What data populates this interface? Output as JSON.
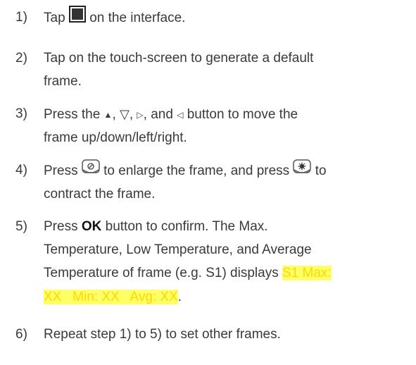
{
  "steps": [
    {
      "number": "1)",
      "before_icon": "Tap",
      "icon": "stop-square-icon",
      "after_icon": "on the interface."
    },
    {
      "number": "2)",
      "line1": "Tap on the touch-screen to generate a default",
      "line2": "frame."
    },
    {
      "number": "3)",
      "press": "Press the",
      "up_glyph": "▲",
      "sep1": ",",
      "down_glyph": "▽",
      "sep2": ",",
      "right_glyph": "▷",
      "sep3": ", and",
      "left_glyph": "◁",
      "rest": "button to move the",
      "line2": "frame up/down/left/right."
    },
    {
      "number": "4)",
      "press": "Press",
      "enlarge_icon": "zoom-out-button-icon",
      "middle": "to enlarge the frame, and press",
      "contract_icon": "zoom-in-button-icon",
      "end": "to",
      "line2": "contract the frame."
    },
    {
      "number": "5)",
      "press": "Press",
      "ok": "OK",
      "line1_rest": "button to confirm. The Max.",
      "line2": "Temperature, Low Temperature, and Average",
      "line3_text": "Temperature of frame (e.g. S1) displays",
      "highlight1": "S1 Max:",
      "highlight2": "XX   Min: XX   Avg: XX",
      "period": "."
    },
    {
      "number": "6)",
      "line1": "Repeat step 1) to 5) to set other frames."
    }
  ],
  "colors": {
    "text": "#3a3a3a",
    "highlight_bg": "#ffff66",
    "highlight_text": "#ffd800"
  }
}
